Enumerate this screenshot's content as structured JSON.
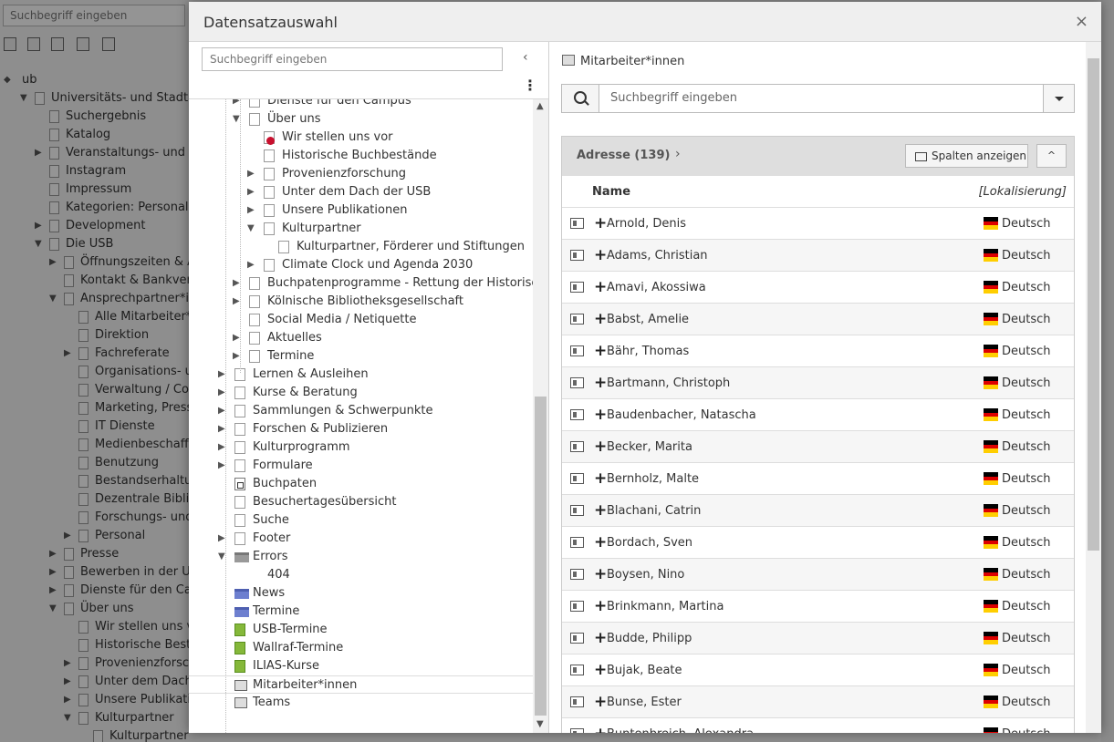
{
  "background": {
    "search_placeholder": "Suchbegriff eingeben",
    "root_label": "ub",
    "tree": [
      {
        "label": "Universitäts- und Stadtbib",
        "indent": 0,
        "toggle": "▼"
      },
      {
        "label": "Suchergebnis",
        "indent": 1,
        "toggle": ""
      },
      {
        "label": "Katalog",
        "indent": 1,
        "toggle": ""
      },
      {
        "label": "Veranstaltungs- und Ku",
        "indent": 1,
        "toggle": "▶"
      },
      {
        "label": "Instagram",
        "indent": 1,
        "toggle": ""
      },
      {
        "label": "Impressum",
        "indent": 1,
        "toggle": ""
      },
      {
        "label": "Kategorien: Personal",
        "indent": 1,
        "toggle": ""
      },
      {
        "label": "Development",
        "indent": 1,
        "toggle": "▶"
      },
      {
        "label": "Die USB",
        "indent": 1,
        "toggle": "▼"
      },
      {
        "label": "Öffnungszeiten & Adr",
        "indent": 2,
        "toggle": "▶"
      },
      {
        "label": "Kontakt & Bankverbin",
        "indent": 2,
        "toggle": ""
      },
      {
        "label": "Ansprechpartner*inne",
        "indent": 2,
        "toggle": "▼"
      },
      {
        "label": "Alle Mitarbeiter*inn",
        "indent": 3,
        "toggle": ""
      },
      {
        "label": "Direktion",
        "indent": 3,
        "toggle": ""
      },
      {
        "label": "Fachreferate",
        "indent": 3,
        "toggle": "▶"
      },
      {
        "label": "Organisations- und",
        "indent": 3,
        "toggle": ""
      },
      {
        "label": "Verwaltung / Contr",
        "indent": 3,
        "toggle": ""
      },
      {
        "label": "Marketing, Presse-",
        "indent": 3,
        "toggle": ""
      },
      {
        "label": "IT Dienste",
        "indent": 3,
        "toggle": ""
      },
      {
        "label": "Medienbeschaffung",
        "indent": 3,
        "toggle": ""
      },
      {
        "label": "Benutzung",
        "indent": 3,
        "toggle": ""
      },
      {
        "label": "Bestandserhaltung",
        "indent": 3,
        "toggle": ""
      },
      {
        "label": "Dezentrale Bibliot",
        "indent": 3,
        "toggle": ""
      },
      {
        "label": "Forschungs- und P",
        "indent": 3,
        "toggle": ""
      },
      {
        "label": "Personal",
        "indent": 3,
        "toggle": "▶"
      },
      {
        "label": "Presse",
        "indent": 2,
        "toggle": "▶"
      },
      {
        "label": "Bewerben in der USB",
        "indent": 2,
        "toggle": "▶"
      },
      {
        "label": "Dienste für den Camp",
        "indent": 2,
        "toggle": "▶"
      },
      {
        "label": "Über uns",
        "indent": 2,
        "toggle": "▼"
      },
      {
        "label": "Wir stellen uns vor",
        "indent": 3,
        "toggle": ""
      },
      {
        "label": "Historische Bestandb",
        "indent": 3,
        "toggle": ""
      },
      {
        "label": "Provenienzforschu",
        "indent": 3,
        "toggle": "▶"
      },
      {
        "label": "Unter dem Dach de",
        "indent": 3,
        "toggle": "▶"
      },
      {
        "label": "Unsere Publikation",
        "indent": 3,
        "toggle": "▶"
      },
      {
        "label": "Kulturpartner",
        "indent": 3,
        "toggle": "▼"
      },
      {
        "label": "Kulturpartner, Förderer und Stiftungen",
        "indent": 4,
        "toggle": ""
      }
    ]
  },
  "modal": {
    "title": "Datensatzauswahl",
    "close_icon": "×",
    "tree_search_placeholder": "Suchbegriff eingeben",
    "collapse_icon": "‹",
    "more_icon": "⋮",
    "tree": [
      {
        "label": "Dienste für den Campus",
        "level": 2,
        "toggle": "▶",
        "icon": "page"
      },
      {
        "label": "Über uns",
        "level": 2,
        "toggle": "▼",
        "icon": "page"
      },
      {
        "label": "Wir stellen uns vor",
        "level": 3,
        "toggle": "",
        "icon": "noaccess"
      },
      {
        "label": "Historische Buchbestände",
        "level": 3,
        "toggle": "",
        "icon": "page"
      },
      {
        "label": "Provenienzforschung",
        "level": 3,
        "toggle": "▶",
        "icon": "page"
      },
      {
        "label": "Unter dem Dach der USB",
        "level": 3,
        "toggle": "▶",
        "icon": "page"
      },
      {
        "label": "Unsere Publikationen",
        "level": 3,
        "toggle": "▶",
        "icon": "page"
      },
      {
        "label": "Kulturpartner",
        "level": 3,
        "toggle": "▼",
        "icon": "page"
      },
      {
        "label": "Kulturpartner, Förderer und Stiftungen",
        "level": 4,
        "toggle": "",
        "icon": "page"
      },
      {
        "label": "Climate Clock und Agenda 2030",
        "level": 3,
        "toggle": "▶",
        "icon": "page"
      },
      {
        "label": "Buchpatenprogramme - Rettung der Historisch",
        "level": 2,
        "toggle": "▶",
        "icon": "page"
      },
      {
        "label": "Kölnische Bibliotheksgesellschaft",
        "level": 2,
        "toggle": "▶",
        "icon": "page"
      },
      {
        "label": "Social Media / Netiquette",
        "level": 2,
        "toggle": "",
        "icon": "page"
      },
      {
        "label": "Aktuelles",
        "level": 2,
        "toggle": "▶",
        "icon": "page"
      },
      {
        "label": "Termine",
        "level": 2,
        "toggle": "▶",
        "icon": "page"
      },
      {
        "label": "Lernen & Ausleihen",
        "level": 1,
        "toggle": "▶",
        "icon": "page"
      },
      {
        "label": "Kurse & Beratung",
        "level": 1,
        "toggle": "▶",
        "icon": "page"
      },
      {
        "label": "Sammlungen & Schwerpunkte",
        "level": 1,
        "toggle": "▶",
        "icon": "page"
      },
      {
        "label": "Forschen & Publizieren",
        "level": 1,
        "toggle": "▶",
        "icon": "page"
      },
      {
        "label": "Kulturprogramm",
        "level": 1,
        "toggle": "▶",
        "icon": "page"
      },
      {
        "label": "Formulare",
        "level": 1,
        "toggle": "▶",
        "icon": "page"
      },
      {
        "label": "Buchpaten",
        "level": 1,
        "toggle": "",
        "icon": "page-link"
      },
      {
        "label": "Besuchertagesübersicht",
        "level": 1,
        "toggle": "",
        "icon": "page"
      },
      {
        "label": "Suche",
        "level": 1,
        "toggle": "",
        "icon": "page"
      },
      {
        "label": "Footer",
        "level": 1,
        "toggle": "▶",
        "icon": "page"
      },
      {
        "label": "Errors",
        "level": 1,
        "toggle": "▼",
        "icon": "folder"
      },
      {
        "label": "404",
        "level": 2,
        "toggle": "",
        "icon": "none"
      },
      {
        "label": "News",
        "level": 1,
        "toggle": "",
        "icon": "folder-blue"
      },
      {
        "label": "Termine",
        "level": 1,
        "toggle": "",
        "icon": "folder-blue"
      },
      {
        "label": "USB-Termine",
        "level": 1,
        "toggle": "",
        "icon": "green"
      },
      {
        "label": "Wallraf-Termine",
        "level": 1,
        "toggle": "",
        "icon": "green"
      },
      {
        "label": "ILIAS-Kurse",
        "level": 1,
        "toggle": "",
        "icon": "green"
      },
      {
        "label": "Mitarbeiter*innen",
        "level": 1,
        "toggle": "",
        "icon": "contact",
        "selected": true
      },
      {
        "label": "Teams",
        "level": 1,
        "toggle": "",
        "icon": "contact"
      }
    ],
    "right": {
      "header_label": "Mitarbeiter*innen",
      "search_placeholder": "Suchbegriff eingeben",
      "list_title": "Adresse (139)",
      "list_chevron": "›",
      "columns_button": "Spalten anzeigen",
      "collapse_button": "^",
      "col_name": "Name",
      "col_localization": "[Lokalisierung]",
      "rows": [
        {
          "name": "Arnold, Denis",
          "lang": "Deutsch"
        },
        {
          "name": "Adams, Christian",
          "lang": "Deutsch"
        },
        {
          "name": "Amavi, Akossiwa",
          "lang": "Deutsch"
        },
        {
          "name": "Babst, Amelie",
          "lang": "Deutsch"
        },
        {
          "name": "Bähr, Thomas",
          "lang": "Deutsch"
        },
        {
          "name": "Bartmann, Christoph",
          "lang": "Deutsch"
        },
        {
          "name": "Baudenbacher, Natascha",
          "lang": "Deutsch"
        },
        {
          "name": "Becker, Marita",
          "lang": "Deutsch"
        },
        {
          "name": "Bernholz, Malte",
          "lang": "Deutsch"
        },
        {
          "name": "Blachani, Catrin",
          "lang": "Deutsch"
        },
        {
          "name": "Bordach, Sven",
          "lang": "Deutsch"
        },
        {
          "name": "Boysen, Nino",
          "lang": "Deutsch"
        },
        {
          "name": "Brinkmann, Martina",
          "lang": "Deutsch"
        },
        {
          "name": "Budde, Philipp",
          "lang": "Deutsch"
        },
        {
          "name": "Bujak, Beate",
          "lang": "Deutsch"
        },
        {
          "name": "Bunse, Ester",
          "lang": "Deutsch"
        },
        {
          "name": "Buntenbreich, Alexandra",
          "lang": "Deutsch"
        }
      ],
      "flag_colors": [
        "#000000",
        "#dd0000",
        "#ffce00"
      ]
    }
  }
}
